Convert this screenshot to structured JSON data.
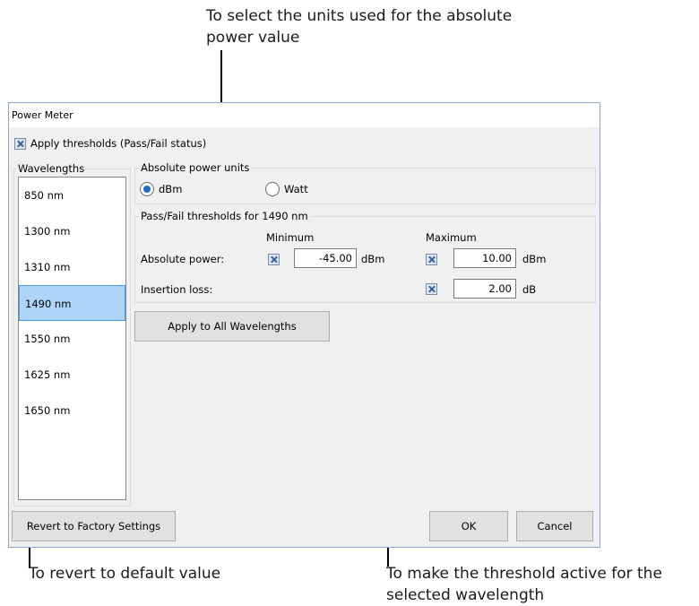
{
  "annotations": {
    "top_line1": "To select the units used for the absolute",
    "top_line2": "power value",
    "bottom_left": "To revert to default value",
    "bottom_right_line1": "To make the threshold active for the",
    "bottom_right_line2": "selected wavelength"
  },
  "dialog": {
    "title": "Power Meter",
    "apply_thresholds_label": "Apply thresholds (Pass/Fail status)",
    "apply_thresholds_checked": true,
    "wavelengths_label": "Wavelengths",
    "wavelengths": [
      "850 nm",
      "1300 nm",
      "1310 nm",
      "1490 nm",
      "1550 nm",
      "1625 nm",
      "1650 nm"
    ],
    "selected_wavelength": "1490 nm",
    "units": {
      "group_label": "Absolute power units",
      "dbm_label": "dBm",
      "watt_label": "Watt",
      "selected": "dBm"
    },
    "thresholds": {
      "group_label": "Pass/Fail thresholds for 1490 nm",
      "minimum_header": "Minimum",
      "maximum_header": "Maximum",
      "absolute_power_label": "Absolute power:",
      "abs_min_value": "-45.00",
      "abs_min_unit": "dBm",
      "abs_max_value": "10.00",
      "abs_max_unit": "dBm",
      "insertion_loss_label": "Insertion loss:",
      "il_max_value": "2.00",
      "il_max_unit": "dB"
    },
    "apply_all_button": "Apply to All Wavelengths",
    "revert_button": "Revert to Factory Settings",
    "ok_button": "OK",
    "cancel_button": "Cancel"
  }
}
